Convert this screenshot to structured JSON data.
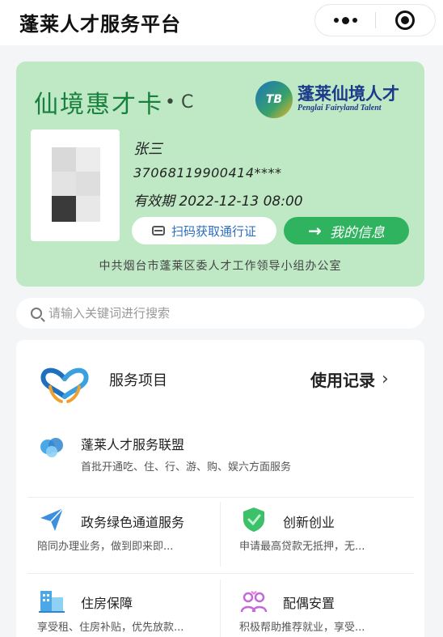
{
  "header": {
    "title": "蓬莱人才服务平台",
    "more_icon": "more-dots-icon",
    "target_icon": "target-icon"
  },
  "card": {
    "title": "仙境惠才卡",
    "level": "• C",
    "logo_cn": "蓬莱仙境人才",
    "logo_en": "Penglai Fairyland Talent",
    "logo_mark": "TB",
    "name": "张三",
    "id_number": "37068119900414****",
    "validity": "有效期 2022-12-13 08:00",
    "scan_button": "扫码获取通行证",
    "info_button": "我的信息",
    "issuer": "中共烟台市蓬莱区委人才工作领导小组办公室",
    "accent_color": "#2fb35e",
    "card_color": "#bfe8c4"
  },
  "search": {
    "placeholder": "请输入关键词进行搜索"
  },
  "services": {
    "title": "服务项目",
    "records_label": "使用记录",
    "items": [
      {
        "title": "蓬莱人才服务联盟",
        "desc": "首批开通吃、住、行、游、购、娱六方面服务",
        "icon": "alliance-icon"
      },
      {
        "title": "政务绿色通道服务",
        "desc": "陪同办理业务，做到即来即...",
        "icon": "paper-plane-icon"
      },
      {
        "title": "创新创业",
        "desc": "申请最高贷款无抵押，无...",
        "icon": "shield-icon"
      },
      {
        "title": "住房保障",
        "desc": "享受租、住房补贴，优先放款...",
        "icon": "building-icon"
      },
      {
        "title": "配偶安置",
        "desc": "积极帮助推荐就业，享受...",
        "icon": "people-icon"
      }
    ]
  }
}
